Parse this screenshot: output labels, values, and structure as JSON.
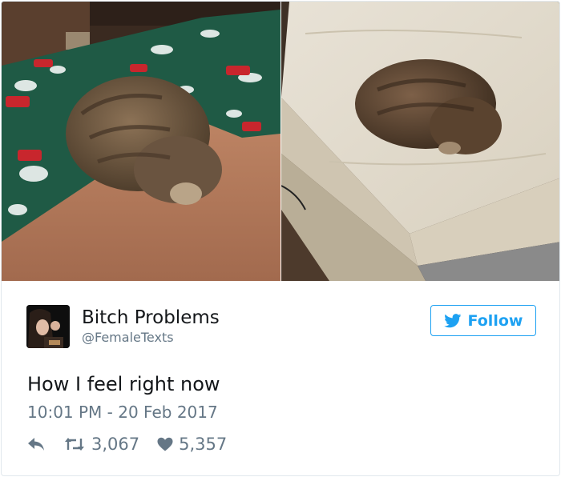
{
  "media": {
    "photos": [
      {
        "name": "cat-face-down-on-blanket-photo"
      },
      {
        "name": "cat-face-down-on-mattress-photo"
      }
    ]
  },
  "author": {
    "display_name": "Bitch Problems",
    "handle": "@FemaleTexts"
  },
  "follow_button": {
    "label": "Follow",
    "icon": "twitter-bird-icon"
  },
  "tweet": {
    "text": "How I feel right now",
    "timestamp": "10:01 PM - 20 Feb 2017"
  },
  "actions": {
    "reply_icon": "reply-icon",
    "retweet_icon": "retweet-icon",
    "retweet_count": "3,067",
    "like_icon": "heart-icon",
    "like_count": "5,357"
  },
  "colors": {
    "accent": "#1da1f2",
    "text": "#14171a",
    "secondary_text": "#657786",
    "border": "#e1e8ed"
  }
}
